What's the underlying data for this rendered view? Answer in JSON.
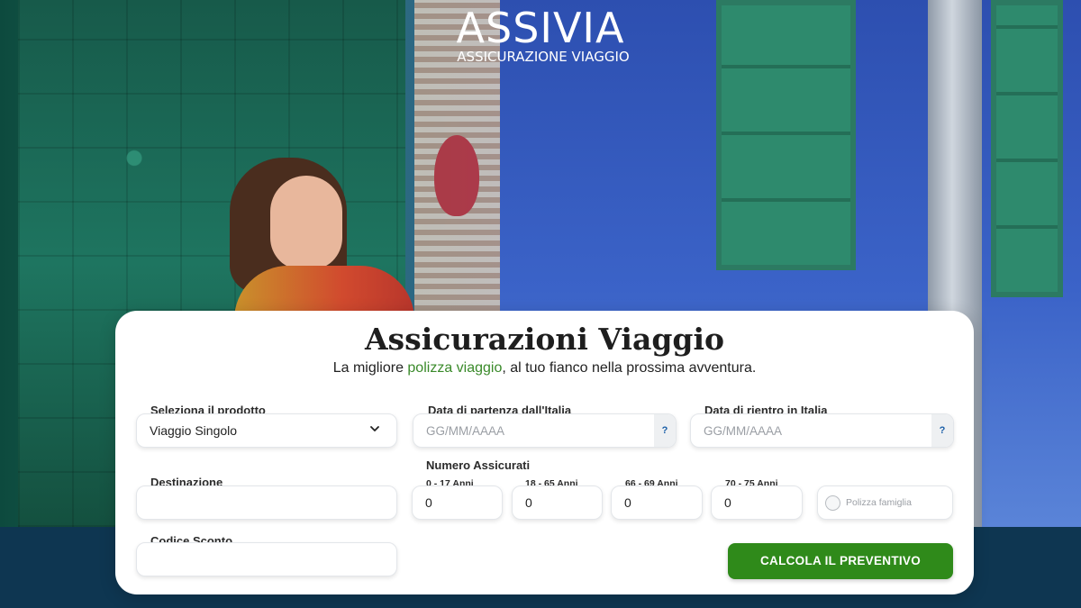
{
  "logo": {
    "brand": "ASSIVIA",
    "tagline": "ASSICURAZIONE VIAGGIO"
  },
  "card": {
    "title": "Assicurazioni Viaggio",
    "subtitle_before": "La migliore ",
    "subtitle_highlight": "polizza viaggio",
    "subtitle_after": ", al tuo fianco nella prossima avventura."
  },
  "form": {
    "product_label": "Seleziona il prodotto",
    "product_value": "Viaggio Singolo",
    "departure_label": "Data di partenza dall'Italia",
    "departure_placeholder": "GG/MM/AAAA",
    "return_label": "Data di rientro in Italia",
    "return_placeholder": "GG/MM/AAAA",
    "help_glyph": "?",
    "destination_label": "Destinazione",
    "destination_value": "",
    "insured_label": "Numero Assicurati",
    "age_groups": [
      {
        "label": "0 - 17 Anni",
        "value": "0"
      },
      {
        "label": "18 - 65 Anni",
        "value": "0"
      },
      {
        "label": "66 - 69 Anni",
        "value": "0"
      },
      {
        "label": "70 - 75 Anni",
        "value": "0"
      }
    ],
    "family_policy_label": "Polizza famiglia",
    "discount_label": "Codice Sconto",
    "discount_value": "",
    "submit_label": "CALCOLA IL PREVENTIVO"
  },
  "colors": {
    "accent_green": "#2f8a1a",
    "highlight_green": "#3a8a2a",
    "footer_navy": "#0e3651",
    "help_blue": "#1b5fa8"
  }
}
